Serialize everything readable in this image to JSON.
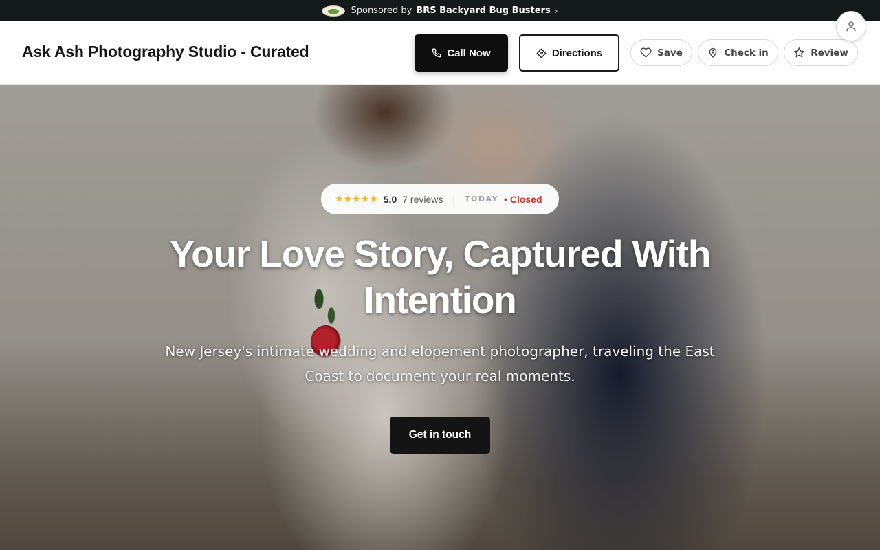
{
  "sponsor": {
    "prefix": "Sponsored by",
    "name": "BRS Backyard Bug Busters",
    "chevron": "›",
    "logo_icon": "brs-logo-icon"
  },
  "header": {
    "business_name": "Ask Ash Photography Studio - Curated",
    "call_label": "Call Now",
    "directions_label": "Directions",
    "save_label": "Save",
    "checkin_label": "Check in",
    "review_label": "Review"
  },
  "hero": {
    "rating": {
      "stars": "★★★★★",
      "value": "5.0",
      "reviews": "7 reviews",
      "today_label": "TODAY",
      "status": "Closed"
    },
    "title": "Your Love Story, Captured With Intention",
    "subtitle": "New Jersey's intimate wedding and elopement photographer, traveling the East Coast to document your real moments.",
    "cta_label": "Get in touch"
  },
  "colors": {
    "sponsor_bg": "#141a1a",
    "primary": "#0e0e0e",
    "star": "#f0b429",
    "closed": "#c0392b"
  }
}
